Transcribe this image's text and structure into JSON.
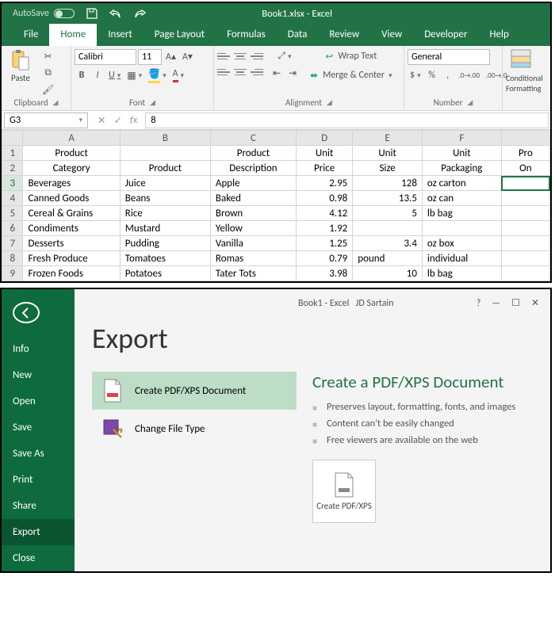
{
  "window": {
    "autosave_label": "AutoSave",
    "autosave_state": "Off",
    "doc_title": "Book1.xlsx - Excel"
  },
  "tabs": [
    "File",
    "Home",
    "Insert",
    "Page Layout",
    "Formulas",
    "Data",
    "Review",
    "View",
    "Developer",
    "Help"
  ],
  "active_tab": "Home",
  "ribbon": {
    "clipboard": {
      "label": "Clipboard",
      "paste": "Paste"
    },
    "font": {
      "label": "Font",
      "name": "Calibri",
      "size": "11",
      "buttons": {
        "bold": "B",
        "italic": "I",
        "underline": "U"
      }
    },
    "alignment": {
      "label": "Alignment",
      "wrap": "Wrap Text",
      "merge": "Merge & Center"
    },
    "number": {
      "label": "Number",
      "format": "General",
      "currency": "$",
      "percent": "%",
      "comma": ","
    },
    "conditional": "Conditional Formatting"
  },
  "fx": {
    "cell_ref": "G3",
    "value": "8"
  },
  "grid": {
    "col_letters": [
      "A",
      "B",
      "C",
      "D",
      "E",
      "F",
      ""
    ],
    "header1": [
      "Product",
      "",
      "Product",
      "Unit",
      "Unit",
      "Unit",
      "Pro"
    ],
    "header2": [
      "Category",
      "Product",
      "Description",
      "Price",
      "Size",
      "Packaging",
      "On"
    ],
    "rows": [
      {
        "n": 3,
        "c": [
          "Beverages",
          "Juice",
          "Apple",
          "2.95",
          "128",
          "oz carton",
          ""
        ]
      },
      {
        "n": 4,
        "c": [
          "Canned Goods",
          "Beans",
          "Baked",
          "0.98",
          "13.5",
          "oz can",
          ""
        ]
      },
      {
        "n": 5,
        "c": [
          "Cereal & Grains",
          "Rice",
          "Brown",
          "4.12",
          "5",
          "lb bag",
          ""
        ]
      },
      {
        "n": 6,
        "c": [
          "Condiments",
          "Mustard",
          "Yellow",
          "1.92",
          "",
          "",
          ""
        ]
      },
      {
        "n": 7,
        "c": [
          "Desserts",
          "Pudding",
          "Vanilla",
          "1.25",
          "3.4",
          "oz box",
          ""
        ]
      },
      {
        "n": 8,
        "c": [
          "Fresh Produce",
          "Tomatoes",
          "Romas",
          "0.79",
          "pound",
          "individual",
          ""
        ]
      },
      {
        "n": 9,
        "c": [
          "Frozen Foods",
          "Potatoes",
          "Tater Tots",
          "3.98",
          "10",
          "lb bag",
          ""
        ]
      }
    ],
    "numeric_cols": [
      3,
      4
    ]
  },
  "backstage": {
    "title": "Book1  -  Excel",
    "user": "JD Sartain",
    "heading": "Export",
    "menu": [
      "Info",
      "New",
      "Open",
      "Save",
      "Save As",
      "Print",
      "Share",
      "Export",
      "Close"
    ],
    "active_menu": "Export",
    "options": [
      {
        "key": "pdf",
        "label": "Create PDF/XPS Document",
        "selected": true
      },
      {
        "key": "cft",
        "label": "Change File Type",
        "selected": false
      }
    ],
    "detail": {
      "heading": "Create a PDF/XPS Document",
      "bullets": [
        "Preserves layout, formatting, fonts, and images",
        "Content can't be easily changed",
        "Free viewers are available on the web"
      ],
      "button": "Create PDF/XPS"
    }
  }
}
